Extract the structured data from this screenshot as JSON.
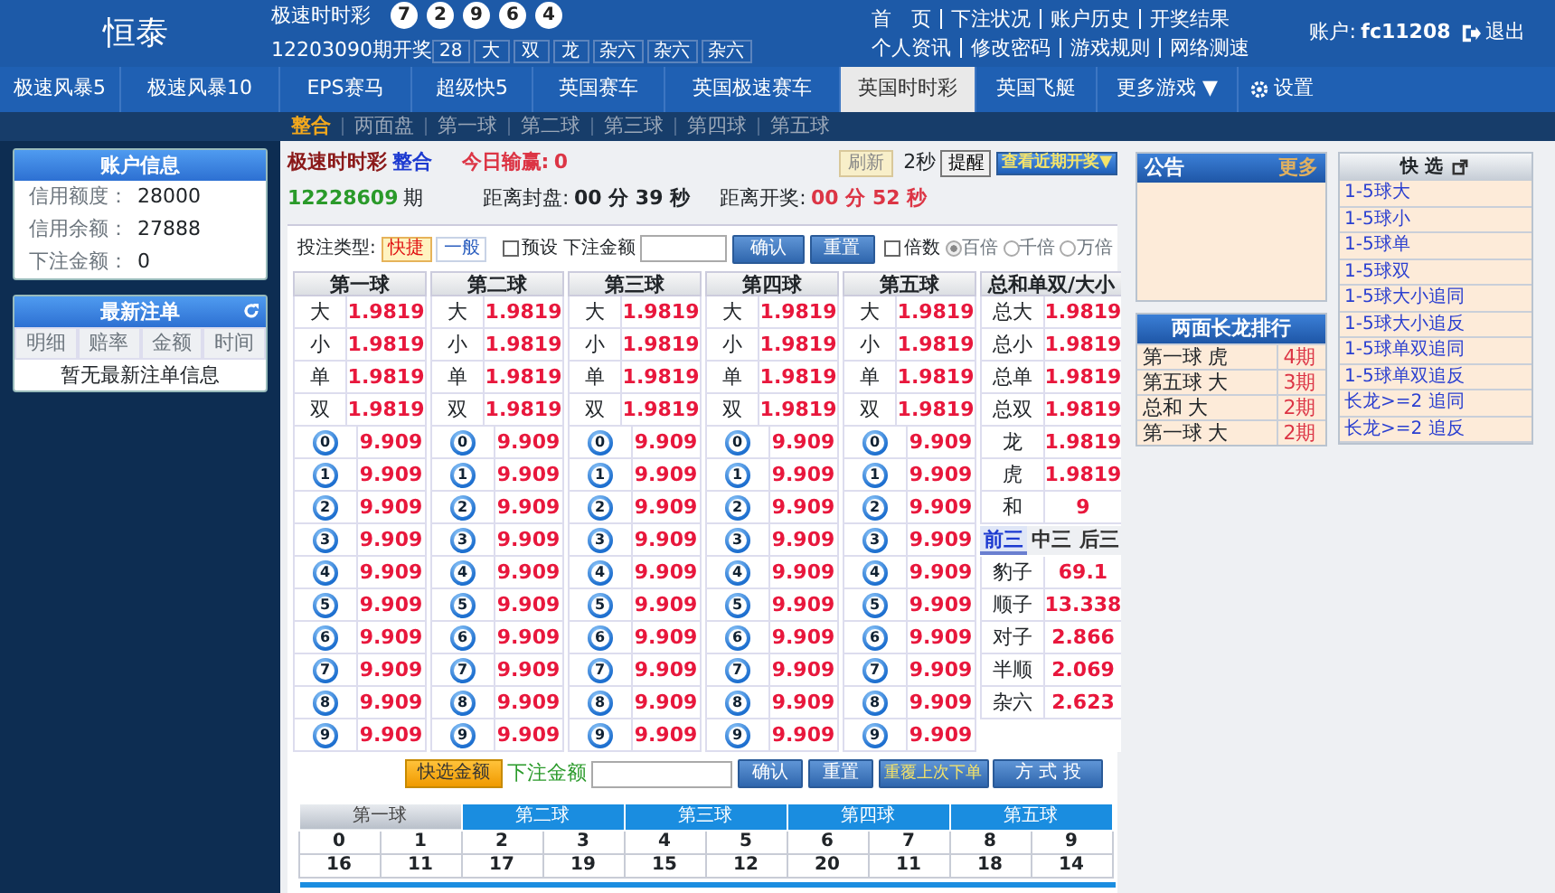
{
  "header": {
    "logo": "恒泰",
    "lottery": "极速时时彩",
    "balls": [
      "7",
      "2",
      "9",
      "6",
      "4"
    ],
    "issue_label": "12203090期开奖",
    "results": [
      "28",
      "大",
      "双",
      "龙",
      "杂六",
      "杂六",
      "杂六"
    ],
    "links": [
      [
        "首　页",
        "下注状况",
        "账户历史",
        "开奖结果"
      ],
      [
        "个人资讯",
        "修改密码",
        "游戏规则",
        "网络测速"
      ]
    ],
    "account_label": "账户:",
    "account": "fc11208",
    "logout": "退出"
  },
  "nav_tabs": [
    {
      "label": "极速风暴5",
      "selected": false
    },
    {
      "label": "极速风暴10",
      "selected": false
    },
    {
      "label": "EPS赛马",
      "selected": false
    },
    {
      "label": "超级快5",
      "selected": false
    },
    {
      "label": "英国赛车",
      "selected": false
    },
    {
      "label": "英国极速赛车",
      "selected": false
    },
    {
      "label": "英国时时彩",
      "selected": true
    },
    {
      "label": "英国飞艇",
      "selected": false
    },
    {
      "label": "更多游戏 ▼",
      "selected": false
    }
  ],
  "settings": "设置",
  "sub_tabs": [
    {
      "label": "整合",
      "selected": true
    },
    {
      "label": "两面盘",
      "selected": false
    },
    {
      "label": "第一球",
      "selected": false
    },
    {
      "label": "第二球",
      "selected": false
    },
    {
      "label": "第三球",
      "selected": false
    },
    {
      "label": "第四球",
      "selected": false
    },
    {
      "label": "第五球",
      "selected": false
    }
  ],
  "sidebar": {
    "account_info": {
      "title": "账户信息",
      "rows": [
        {
          "label": "信用额度：",
          "value": "28000"
        },
        {
          "label": "信用余额：",
          "value": "27888"
        },
        {
          "label": "下注金额：",
          "value": "0"
        }
      ]
    },
    "recent_bets": {
      "title": "最新注单",
      "columns": [
        "明细",
        "赔率",
        "金额",
        "时间"
      ],
      "empty": "暂无最新注单信息"
    }
  },
  "info": {
    "lottery": "极速时时彩",
    "mode": "整合",
    "today_label": "今日输赢:",
    "today_value": "0",
    "refresh": "刷新",
    "interval": "2秒",
    "remind": "提醒",
    "recent_draws": "查看近期开奖▼",
    "issue": "12228609",
    "issue_suffix": "期",
    "close_label": "距离封盘:",
    "close_time": "00 分 39 秒",
    "open_label": "距离开奖:",
    "open_time": "00 分 52 秒"
  },
  "bet_form": {
    "type_label": "投注类型:",
    "types": [
      {
        "label": "快捷",
        "selected": true
      },
      {
        "label": "一般",
        "selected": false
      }
    ],
    "preset": {
      "label": "预设",
      "checked": false
    },
    "amount_label": "下注金额",
    "confirm": "确认",
    "reset": "重置",
    "multiplier": {
      "label": "倍数",
      "checked": false
    },
    "scales": [
      {
        "label": "百倍",
        "selected": true
      },
      {
        "label": "千倍",
        "selected": false
      },
      {
        "label": "万倍",
        "selected": false
      }
    ]
  },
  "ball_columns": [
    {
      "title": "第一球",
      "rows": [
        {
          "kind": "text",
          "name": "大",
          "odds": "1.9819"
        },
        {
          "kind": "text",
          "name": "小",
          "odds": "1.9819"
        },
        {
          "kind": "text",
          "name": "单",
          "odds": "1.9819"
        },
        {
          "kind": "text",
          "name": "双",
          "odds": "1.9819"
        },
        {
          "kind": "ball",
          "name": "0",
          "odds": "9.909"
        },
        {
          "kind": "ball",
          "name": "1",
          "odds": "9.909"
        },
        {
          "kind": "ball",
          "name": "2",
          "odds": "9.909"
        },
        {
          "kind": "ball",
          "name": "3",
          "odds": "9.909"
        },
        {
          "kind": "ball",
          "name": "4",
          "odds": "9.909"
        },
        {
          "kind": "ball",
          "name": "5",
          "odds": "9.909"
        },
        {
          "kind": "ball",
          "name": "6",
          "odds": "9.909"
        },
        {
          "kind": "ball",
          "name": "7",
          "odds": "9.909"
        },
        {
          "kind": "ball",
          "name": "8",
          "odds": "9.909"
        },
        {
          "kind": "ball",
          "name": "9",
          "odds": "9.909"
        }
      ]
    },
    {
      "title": "第二球",
      "rows": [
        {
          "kind": "text",
          "name": "大",
          "odds": "1.9819"
        },
        {
          "kind": "text",
          "name": "小",
          "odds": "1.9819"
        },
        {
          "kind": "text",
          "name": "单",
          "odds": "1.9819"
        },
        {
          "kind": "text",
          "name": "双",
          "odds": "1.9819"
        },
        {
          "kind": "ball",
          "name": "0",
          "odds": "9.909"
        },
        {
          "kind": "ball",
          "name": "1",
          "odds": "9.909"
        },
        {
          "kind": "ball",
          "name": "2",
          "odds": "9.909"
        },
        {
          "kind": "ball",
          "name": "3",
          "odds": "9.909"
        },
        {
          "kind": "ball",
          "name": "4",
          "odds": "9.909"
        },
        {
          "kind": "ball",
          "name": "5",
          "odds": "9.909"
        },
        {
          "kind": "ball",
          "name": "6",
          "odds": "9.909"
        },
        {
          "kind": "ball",
          "name": "7",
          "odds": "9.909"
        },
        {
          "kind": "ball",
          "name": "8",
          "odds": "9.909"
        },
        {
          "kind": "ball",
          "name": "9",
          "odds": "9.909"
        }
      ]
    },
    {
      "title": "第三球",
      "rows": [
        {
          "kind": "text",
          "name": "大",
          "odds": "1.9819"
        },
        {
          "kind": "text",
          "name": "小",
          "odds": "1.9819"
        },
        {
          "kind": "text",
          "name": "单",
          "odds": "1.9819"
        },
        {
          "kind": "text",
          "name": "双",
          "odds": "1.9819"
        },
        {
          "kind": "ball",
          "name": "0",
          "odds": "9.909"
        },
        {
          "kind": "ball",
          "name": "1",
          "odds": "9.909"
        },
        {
          "kind": "ball",
          "name": "2",
          "odds": "9.909"
        },
        {
          "kind": "ball",
          "name": "3",
          "odds": "9.909"
        },
        {
          "kind": "ball",
          "name": "4",
          "odds": "9.909"
        },
        {
          "kind": "ball",
          "name": "5",
          "odds": "9.909"
        },
        {
          "kind": "ball",
          "name": "6",
          "odds": "9.909"
        },
        {
          "kind": "ball",
          "name": "7",
          "odds": "9.909"
        },
        {
          "kind": "ball",
          "name": "8",
          "odds": "9.909"
        },
        {
          "kind": "ball",
          "name": "9",
          "odds": "9.909"
        }
      ]
    },
    {
      "title": "第四球",
      "rows": [
        {
          "kind": "text",
          "name": "大",
          "odds": "1.9819"
        },
        {
          "kind": "text",
          "name": "小",
          "odds": "1.9819"
        },
        {
          "kind": "text",
          "name": "单",
          "odds": "1.9819"
        },
        {
          "kind": "text",
          "name": "双",
          "odds": "1.9819"
        },
        {
          "kind": "ball",
          "name": "0",
          "odds": "9.909"
        },
        {
          "kind": "ball",
          "name": "1",
          "odds": "9.909"
        },
        {
          "kind": "ball",
          "name": "2",
          "odds": "9.909"
        },
        {
          "kind": "ball",
          "name": "3",
          "odds": "9.909"
        },
        {
          "kind": "ball",
          "name": "4",
          "odds": "9.909"
        },
        {
          "kind": "ball",
          "name": "5",
          "odds": "9.909"
        },
        {
          "kind": "ball",
          "name": "6",
          "odds": "9.909"
        },
        {
          "kind": "ball",
          "name": "7",
          "odds": "9.909"
        },
        {
          "kind": "ball",
          "name": "8",
          "odds": "9.909"
        },
        {
          "kind": "ball",
          "name": "9",
          "odds": "9.909"
        }
      ]
    },
    {
      "title": "第五球",
      "rows": [
        {
          "kind": "text",
          "name": "大",
          "odds": "1.9819"
        },
        {
          "kind": "text",
          "name": "小",
          "odds": "1.9819"
        },
        {
          "kind": "text",
          "name": "单",
          "odds": "1.9819"
        },
        {
          "kind": "text",
          "name": "双",
          "odds": "1.9819"
        },
        {
          "kind": "ball",
          "name": "0",
          "odds": "9.909"
        },
        {
          "kind": "ball",
          "name": "1",
          "odds": "9.909"
        },
        {
          "kind": "ball",
          "name": "2",
          "odds": "9.909"
        },
        {
          "kind": "ball",
          "name": "3",
          "odds": "9.909"
        },
        {
          "kind": "ball",
          "name": "4",
          "odds": "9.909"
        },
        {
          "kind": "ball",
          "name": "5",
          "odds": "9.909"
        },
        {
          "kind": "ball",
          "name": "6",
          "odds": "9.909"
        },
        {
          "kind": "ball",
          "name": "7",
          "odds": "9.909"
        },
        {
          "kind": "ball",
          "name": "8",
          "odds": "9.909"
        },
        {
          "kind": "ball",
          "name": "9",
          "odds": "9.909"
        }
      ]
    }
  ],
  "sum_column": {
    "title": "总和单双/大小",
    "rows": [
      {
        "name": "总大",
        "odds": "1.9819"
      },
      {
        "name": "总小",
        "odds": "1.9819"
      },
      {
        "name": "总单",
        "odds": "1.9819"
      },
      {
        "name": "总双",
        "odds": "1.9819"
      },
      {
        "name": "龙",
        "odds": "1.9819"
      },
      {
        "name": "虎",
        "odds": "1.9819"
      },
      {
        "name": "和",
        "odds": "9"
      }
    ],
    "tabs": [
      {
        "label": "前三",
        "selected": true
      },
      {
        "label": "中三",
        "selected": false
      },
      {
        "label": "后三",
        "selected": false
      }
    ],
    "group_rows": [
      {
        "name": "豹子",
        "odds": "69.1"
      },
      {
        "name": "顺子",
        "odds": "13.338"
      },
      {
        "name": "对子",
        "odds": "2.866"
      },
      {
        "name": "半顺",
        "odds": "2.069"
      },
      {
        "name": "杂六",
        "odds": "2.623"
      }
    ]
  },
  "bottom_bar": {
    "quick_amount": "快选金额",
    "amount_label": "下注金额",
    "confirm": "确认",
    "reset": "重置",
    "repeat": "重覆上次下单",
    "mode": "方 式 投"
  },
  "stats": [
    {
      "title": "第一球",
      "selected": true,
      "cells": [
        {
          "number": "0",
          "count": "16"
        },
        {
          "number": "1",
          "count": "11"
        }
      ]
    },
    {
      "title": "第二球",
      "selected": false,
      "cells": [
        {
          "number": "2",
          "count": "17"
        },
        {
          "number": "3",
          "count": "19"
        }
      ]
    },
    {
      "title": "第三球",
      "selected": false,
      "cells": [
        {
          "number": "4",
          "count": "15"
        },
        {
          "number": "5",
          "count": "12"
        }
      ]
    },
    {
      "title": "第四球",
      "selected": false,
      "cells": [
        {
          "number": "6",
          "count": "20"
        },
        {
          "number": "7",
          "count": "11"
        }
      ]
    },
    {
      "title": "第五球",
      "selected": false,
      "cells": [
        {
          "number": "8",
          "count": "18"
        },
        {
          "number": "9",
          "count": "14"
        }
      ]
    }
  ],
  "notice": {
    "title": "公告",
    "more": "更多"
  },
  "long_dragon": {
    "title": "两面长龙排行",
    "rows": [
      {
        "name": "第一球 虎",
        "periods": "4期"
      },
      {
        "name": "第五球 大",
        "periods": "3期"
      },
      {
        "name": "总和 大",
        "periods": "2期"
      },
      {
        "name": "第一球 大",
        "periods": "2期"
      }
    ]
  },
  "quick_select": {
    "title": "快 选",
    "items": [
      "1-5球大",
      "1-5球小",
      "1-5球单",
      "1-5球双",
      "1-5球大小追同",
      "1-5球大小追反",
      "1-5球单双追同",
      "1-5球单双追反",
      "长龙>=2 追同",
      "长龙>=2 追反"
    ]
  }
}
